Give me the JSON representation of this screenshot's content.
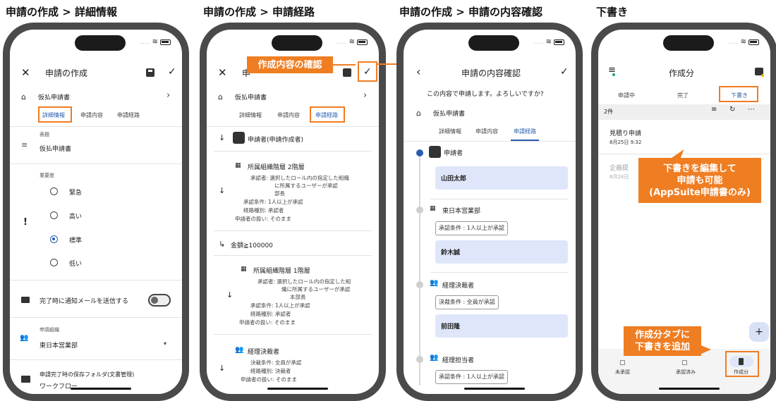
{
  "captions": [
    "申請の作成 > 詳細情報",
    "申請の作成 > 申請経路",
    "申請の作成 > 申請の内容確認",
    "下書き"
  ],
  "status": {
    "dots": "....",
    "wifi": "wifi-icon",
    "battery": "battery-icon"
  },
  "p1": {
    "title": "申請の作成",
    "form_name": "仮払申請書",
    "tabs": [
      "詳細情報",
      "申請内容",
      "申請経路"
    ],
    "subject_label": "表題",
    "subject_value": "仮払申請書",
    "importance_label": "重要度",
    "importance_options": [
      "緊急",
      "高い",
      "標準",
      "低い"
    ],
    "importance_selected": "標準",
    "mail_label": "完了時に通知メールを送信する",
    "org_label": "申請組織",
    "org_value": "東日本営業部",
    "folder_label": "申請完了時の保存フォルダ(文書管理)",
    "folder_value": "ワークフロー"
  },
  "p2": {
    "title": "申",
    "form_name": "仮払申請書",
    "tabs": [
      "詳細情報",
      "申請内容",
      "申請経路"
    ],
    "callout": "作成内容の確認",
    "applicant": "申請者(申請作成者)",
    "step1_title": "所属組織階層 2階層",
    "step1_lines": [
      "承認者: 選択したロール内の指定した組織",
      "に所属するユーザーが承認",
      "部長",
      "承認条件: 1人以上が承認",
      "経路種別: 承認者",
      "申請者の扱い: そのまま"
    ],
    "branch": "金額≧100000",
    "step2_title": "所属組織階層 1階層",
    "step2_lines": [
      "承認者: 選択したロール内の指定した組",
      "織に所属するユーザーが承認",
      "本部長",
      "承認条件: 1人以上が承認",
      "経路種別: 承認者",
      "申請者の扱い: そのまま"
    ],
    "step3_title": "経理決裁者",
    "step3_lines": [
      "決裁条件: 全員が承認",
      "経路種別: 決裁者",
      "申請者の扱い: そのまま"
    ]
  },
  "p3": {
    "title": "申請の内容確認",
    "confirm": "この内容で申請します。よろしいですか?",
    "form_name": "仮払申請書",
    "tabs": [
      "詳細情報",
      "申請内容",
      "申請経路"
    ],
    "r1_label": "申請者",
    "r1_name": "山田太郎",
    "r2_label": "東日本営業部",
    "r2_cond": "承認条件 : 1人以上が承認",
    "r2_name": "鈴木誠",
    "r3_label": "経理決裁者",
    "r3_cond": "決裁条件 : 全員が承認",
    "r3_name": "前田隆",
    "r4_label": "経理担当者",
    "r4_cond": "承認条件 : 1人以上が承認"
  },
  "p4": {
    "title": "作成分",
    "tabs": [
      "申請中",
      "完了",
      "下書き"
    ],
    "count": "2件",
    "item1_title": "見積り申請",
    "item1_date": "8月25日 9:32",
    "item2_title": "企画提",
    "item2_date": "8月24日",
    "callout1": "下書きを編集して\n申請も可能\n(AppSuite申請書のみ)",
    "callout2": "作成分タブに\n下書きを追加",
    "fab": "+",
    "nav": [
      "未承認",
      "承認済み",
      "作成分"
    ]
  }
}
